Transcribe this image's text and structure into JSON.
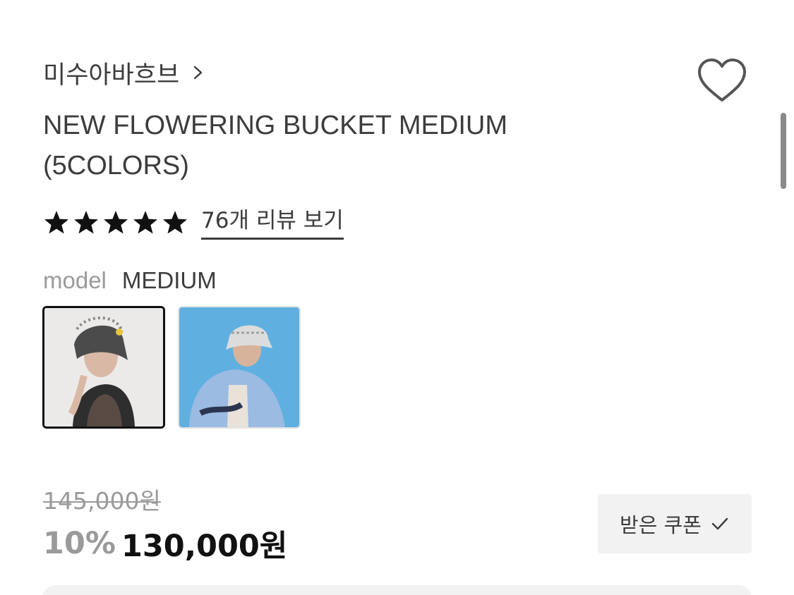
{
  "brand": {
    "name": "미수아바흐브"
  },
  "product": {
    "title_line1": "NEW FLOWERING BUCKET MEDIUM",
    "title_line2": "(5COLORS)",
    "rating_stars": 5,
    "review_link": "76개 리뷰 보기"
  },
  "model": {
    "label": "model",
    "value": "MEDIUM"
  },
  "thumbnails": [
    {
      "name": "model-photo-black-hat",
      "selected": true
    },
    {
      "name": "model-photo-white-hat",
      "selected": false
    }
  ],
  "price": {
    "original": "145,000원",
    "discount": "10%",
    "sale": "130,000원"
  },
  "coupon": {
    "label": "받은 쿠폰"
  },
  "icons": {
    "brand_chevron": "chevron-right-icon",
    "wishlist": "heart-outline-icon",
    "star": "star-filled-icon",
    "coupon_check": "check-icon"
  },
  "colors": {
    "text": "#3c3c3c",
    "muted": "#9a9a9a",
    "price": "#111111",
    "button_bg": "#f2f2f2"
  }
}
